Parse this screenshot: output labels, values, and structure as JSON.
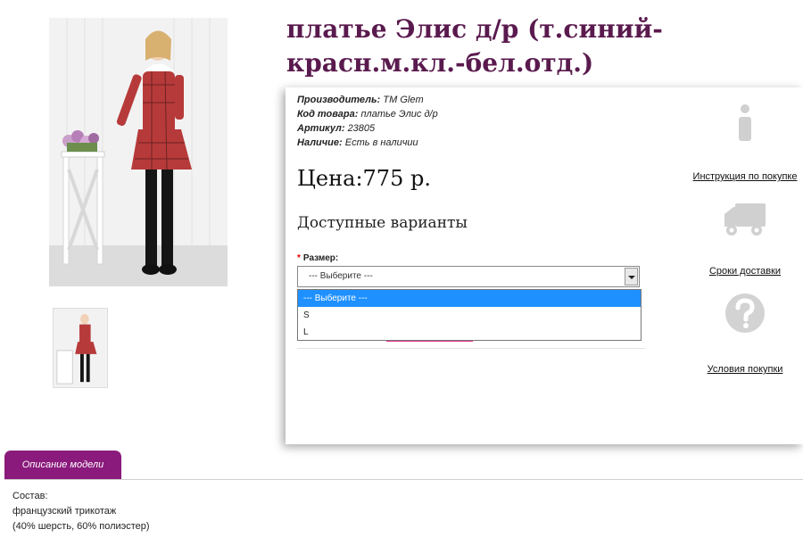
{
  "product": {
    "title": "платье Элис д/р (т.синий-красн.м.кл.-бел.отд.)",
    "meta": [
      {
        "key": "Производитель:",
        "value": "ТМ Glem"
      },
      {
        "key": "Код товара:",
        "value": "платье Элис д/р"
      },
      {
        "key": "Артикул:",
        "value": "23805"
      },
      {
        "key": "Наличие:",
        "value": "Есть в наличии"
      }
    ],
    "price": "Цена:775 р.",
    "options_heading": "Доступные варианты",
    "size_label": "Размер:",
    "size_required_mark": "*",
    "size_selected": "--- Выберите ---",
    "size_options": [
      "--- Выберите ---",
      "S",
      "L"
    ]
  },
  "sidebar_links": [
    {
      "label": "Инструкция по покупке",
      "icon": "info-icon"
    },
    {
      "label": "Сроки доставки",
      "icon": "truck-icon"
    },
    {
      "label": "Условия покупки",
      "icon": "question-icon"
    }
  ],
  "tabs": {
    "description_tab": "Описание модели"
  },
  "description": {
    "lines": [
      "Состав:",
      "французский трикотаж",
      "(40% шерсть, 60% полиэстер)"
    ]
  },
  "colors": {
    "title": "#5a1a4e",
    "tab": "#8a1a7c",
    "highlight": "#1e90ff",
    "button": "#e6338a"
  }
}
